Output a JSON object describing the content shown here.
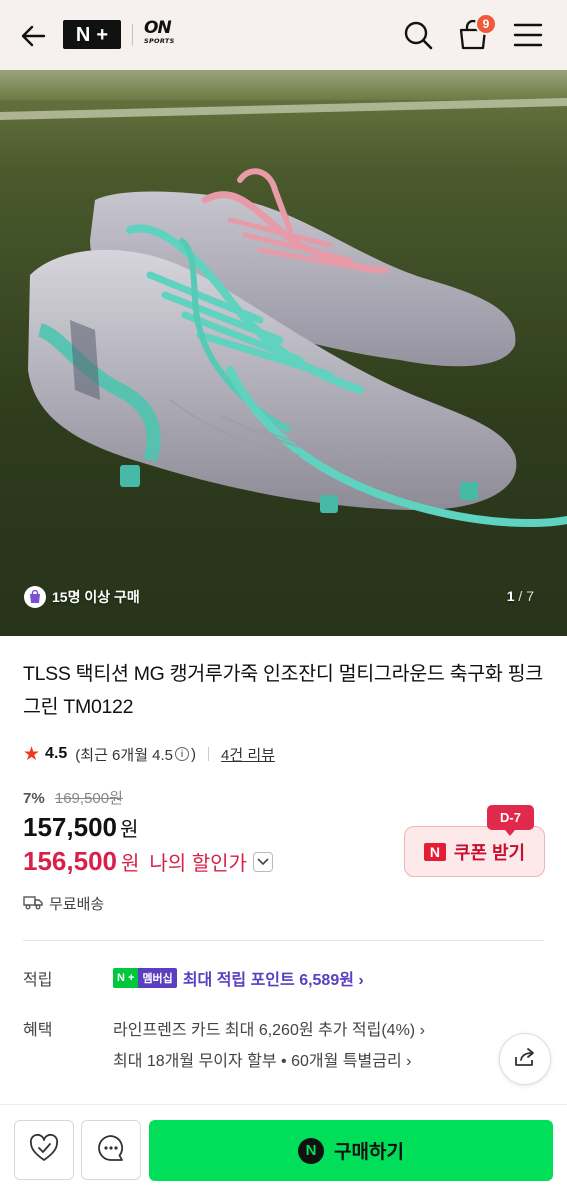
{
  "header": {
    "brand_nplus": [
      "N",
      "+"
    ],
    "brand_on": "ON",
    "brand_on_sub": "SPORTS",
    "cart_count": "9"
  },
  "hero": {
    "buyers_badge": "15명 이상 구매",
    "page_current": "1",
    "page_total": "/ 7"
  },
  "product": {
    "title": "TLSS 택티션 MG 캥거루가죽 인조잔디 멀티그라운드 축구화 핑크 그린 TM0122",
    "rating_score": "4.5",
    "rating_recent_prefix": "(최근 6개월 4.5",
    "rating_recent_suffix": ")",
    "review_count": "4건 리뷰",
    "discount_pct": "7%",
    "original_price": "169,500원",
    "price": "157,500",
    "price_unit": "원",
    "my_price": "156,500",
    "my_price_unit": "원",
    "my_price_label": "나의 할인가",
    "coupon_label": "쿠폰 받기",
    "coupon_n": "N",
    "coupon_dday": "D-7",
    "shipping": "무료배송"
  },
  "benefits": {
    "points_label": "적립",
    "points_badge_left": "N +",
    "points_badge_right": "멤버십",
    "points_text": "최대 적립 포인트 6,589원 ›",
    "benefit_label": "혜택",
    "benefit_line1": "라인프렌즈 카드 최대 6,260원 추가 적립(4%) ›",
    "benefit_line2": "최대 18개월 무이자 할부 • 60개월 특별금리 ›"
  },
  "bottom_bar": {
    "buy_label": "구매하기",
    "buy_icon_letter": "N"
  },
  "colors": {
    "header_bg": "#f6f1ee",
    "sale_red": "#d8214a",
    "badge_orange": "#f05a3a",
    "membership_purple": "#5a3fc0",
    "naver_green": "#00de5a"
  }
}
